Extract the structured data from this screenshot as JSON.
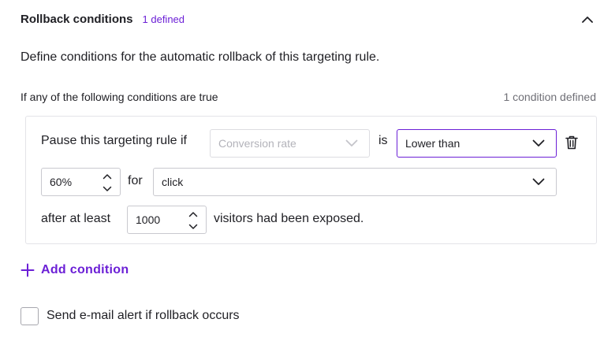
{
  "section": {
    "title": "Rollback conditions",
    "badge": "1 defined",
    "description": "Define conditions for the automatic rollback of this targeting rule."
  },
  "conditions": {
    "header_left": "If any of the following conditions are true",
    "header_right": "1 condition defined",
    "items": [
      {
        "prefix": "Pause this targeting rule if",
        "metric": "Conversion rate",
        "is_label": "is",
        "comparator": "Lower than",
        "threshold": "60%",
        "for_label": "for",
        "event": "click",
        "after_label": "after at least",
        "visitors": "1000",
        "suffix": "visitors had been exposed."
      }
    ]
  },
  "add_condition_label": "Add condition",
  "email_alert": {
    "label": "Send e-mail alert if rollback occurs",
    "checked": false
  },
  "colors": {
    "accent": "#6b1fd6",
    "text": "#1f1f24",
    "muted": "#6f6f76",
    "border": "#c9c9cf"
  }
}
